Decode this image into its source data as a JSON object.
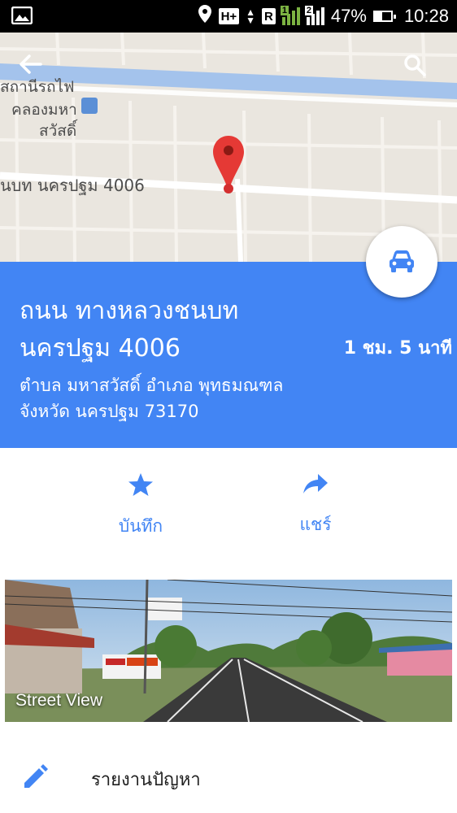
{
  "status_bar": {
    "battery_percent_text": "47%",
    "battery_level": 0.47,
    "time": "10:28",
    "network_h": "H+",
    "roaming": "R",
    "sim1": "1",
    "sim2": "2",
    "icons": [
      "image-icon",
      "location-icon",
      "network-type-icon",
      "roaming-icon",
      "signal-sim1-icon",
      "signal-sim2-icon",
      "battery-icon"
    ]
  },
  "map": {
    "station_label_line1": "สถานีรถไฟ",
    "station_label_line2": "คลองมหา",
    "station_label_line3": "สวัสดิ์",
    "road_label": "นบท นครปฐม 4006",
    "colors": {
      "land": "#eae6df",
      "water": "#a4c3ec",
      "road": "#ffffff",
      "marker": "#e53935"
    }
  },
  "place": {
    "title": "ถนน ทางหลวงชนบท นครปฐม 4006",
    "duration": "1 ชม. 5 นาที",
    "address_line1": "ตำบล มหาสวัสดิ์ อำเภอ พุทธมณฑล",
    "address_line2": "จังหวัด นครปฐม 73170"
  },
  "actions": {
    "save_label": "บันทึก",
    "share_label": "แชร์"
  },
  "street_view": {
    "label": "Street View"
  },
  "report": {
    "label": "รายงานปัญหา"
  },
  "colors": {
    "accent": "#4285f4",
    "header_bg": "#4285f4",
    "text_dark": "#212121"
  }
}
